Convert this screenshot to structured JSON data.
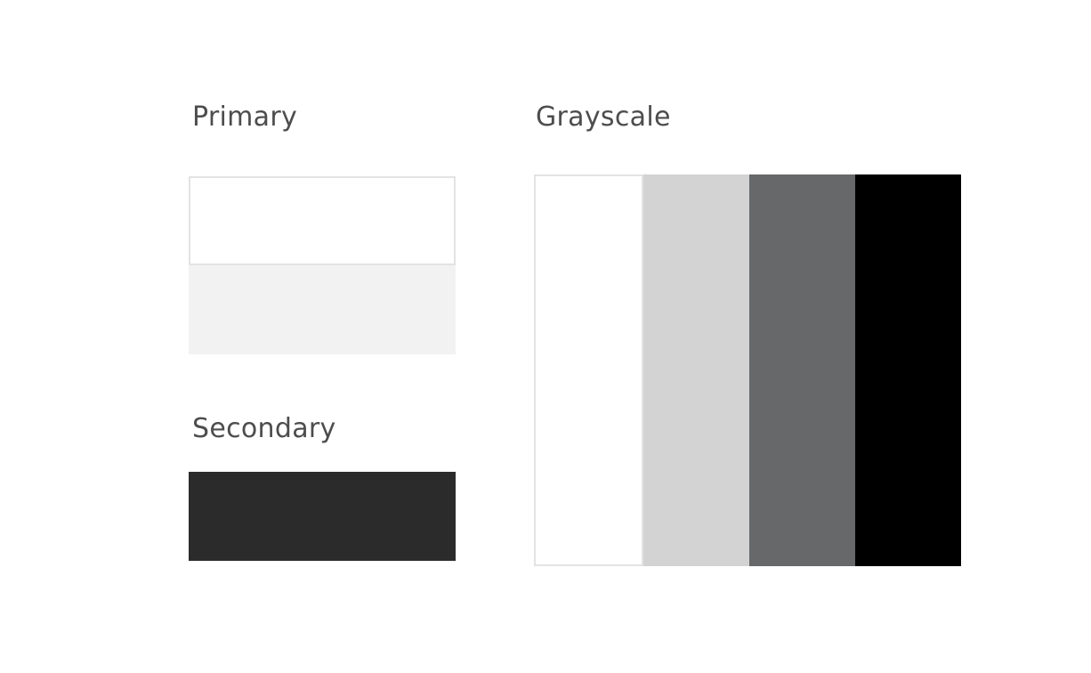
{
  "primary": {
    "title": "Primary",
    "swatches": [
      "#ffffff",
      "#f2f2f2"
    ]
  },
  "secondary": {
    "title": "Secondary",
    "swatches": [
      "#2b2b2b"
    ]
  },
  "grayscale": {
    "title": "Grayscale",
    "swatches": [
      "#ffffff",
      "#d3d3d3",
      "#67686a",
      "#000000"
    ]
  },
  "colors": {
    "heading_text": "#4d4d4d",
    "swatch_border": "#e3e3e3"
  }
}
